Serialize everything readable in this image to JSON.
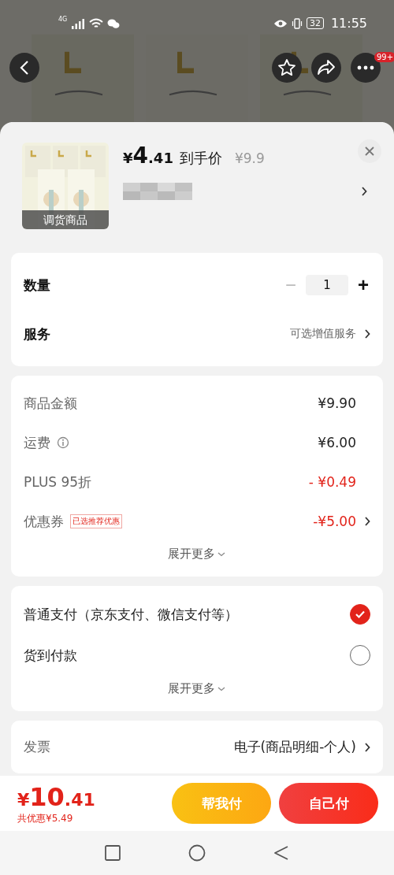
{
  "status_bar": {
    "network": "4G",
    "battery": "32",
    "time": "11:55"
  },
  "top_bar": {
    "badge": "99+"
  },
  "product": {
    "currency": "¥",
    "price_int": "4",
    "price_dec": ".41",
    "price_label": "到手价",
    "original_price": "¥9.9",
    "tag": "调货商品"
  },
  "quantity": {
    "label": "数量",
    "minus": "−",
    "value": "1",
    "plus": "+",
    "minus_disabled": true
  },
  "service": {
    "label": "服务",
    "value": "可选增值服务"
  },
  "fees": [
    {
      "kind": "plain",
      "label": "商品金额",
      "value": "¥9.90"
    },
    {
      "kind": "info",
      "label": "运费",
      "value": "¥6.00"
    },
    {
      "kind": "discount",
      "label": "PLUS 95折",
      "value": "- ¥0.49"
    },
    {
      "kind": "coupon",
      "label": "优惠券",
      "tag": "已选推荐优惠",
      "value": "-¥5.00"
    }
  ],
  "fees_more": "展开更多",
  "payments": [
    {
      "label": "普通支付（京东支付、微信支付等）",
      "selected": true
    },
    {
      "label": "货到付款",
      "selected": false
    }
  ],
  "payments_more": "展开更多",
  "invoice": {
    "label": "发票",
    "value": "电子(商品明细-个人)"
  },
  "footer": {
    "currency": "¥",
    "total_int": "10",
    "total_dec": ".41",
    "saving": "共优惠¥5.49",
    "buttons": [
      {
        "kind": "friend",
        "label": "帮我付"
      },
      {
        "kind": "self",
        "label": "自己付"
      }
    ]
  }
}
